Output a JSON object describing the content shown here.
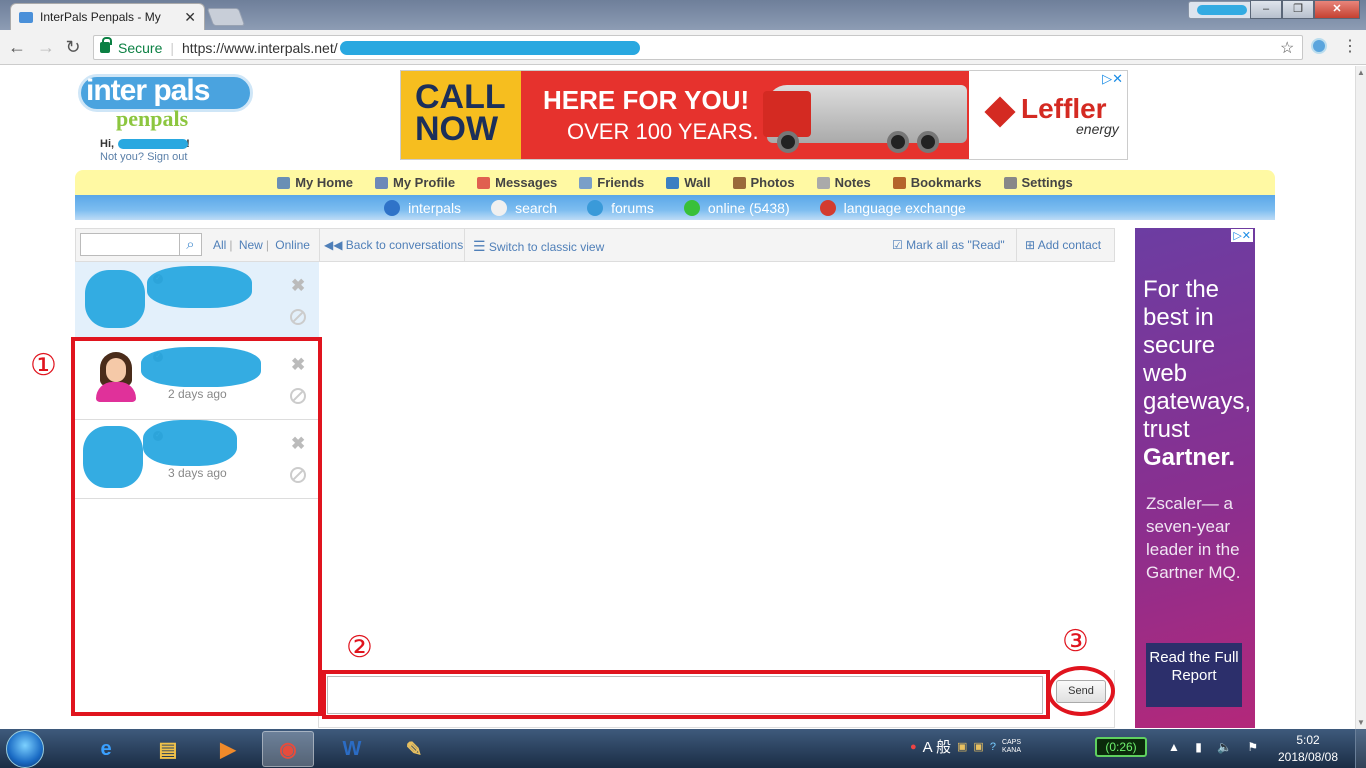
{
  "browser": {
    "tab_title": "InterPals Penpals - My",
    "secure_label": "Secure",
    "url": "https://www.interpals.net/"
  },
  "site": {
    "greeting": "Hi,",
    "greeting_end": "!",
    "not_you": "Not you? Sign out",
    "logo_top": "inter pals",
    "logo_bottom": "penpals"
  },
  "banner_ad": {
    "call_now": "CALL NOW",
    "headline": "HERE FOR YOU!",
    "subline": "OVER 100 YEARS.",
    "brand": "Leffler",
    "brand_sub": "energy"
  },
  "nav_primary": [
    {
      "label": "My Home",
      "color": "#6a8fb5"
    },
    {
      "label": "My Profile",
      "color": "#6d88b8"
    },
    {
      "label": "Messages",
      "color": "#e06050"
    },
    {
      "label": "Friends",
      "color": "#7a9fc8"
    },
    {
      "label": "Wall",
      "color": "#3b7fc2"
    },
    {
      "label": "Photos",
      "color": "#9a6a3a"
    },
    {
      "label": "Notes",
      "color": "#aaaaaa"
    },
    {
      "label": "Bookmarks",
      "color": "#b5652a"
    },
    {
      "label": "Settings",
      "color": "#888888"
    }
  ],
  "nav_secondary": [
    {
      "label": "interpals",
      "color": "#2f73c8"
    },
    {
      "label": "search",
      "color": "#f0f0f0"
    },
    {
      "label": "forums",
      "color": "#3a9ad9"
    },
    {
      "label": "online (5438)",
      "color": "#39c039"
    },
    {
      "label": "language exchange",
      "color": "#d33b2f"
    }
  ],
  "messenger": {
    "filters": [
      "All",
      "New",
      "Online"
    ],
    "back": "Back to conversations",
    "classic": "Switch to classic view",
    "mark_read": "Mark all as \"Read\"",
    "add_contact": "Add contact",
    "send": "Send",
    "conversations": [
      {
        "time": ""
      },
      {
        "time": "2 days ago"
      },
      {
        "time": "3 days ago"
      }
    ]
  },
  "annotations": [
    "①",
    "②",
    "③"
  ],
  "side_ad": {
    "line1": "For the best in secure web gateways, trust",
    "brand": "Gartner.",
    "body": "Zscaler— a seven-year leader in the Gartner MQ.",
    "cta": "Read the Full Report"
  },
  "taskbar": {
    "ime": "A 般",
    "caps": "CAPS KANA",
    "battery": "0:26",
    "time": "5:02",
    "date": "2018/08/08"
  }
}
